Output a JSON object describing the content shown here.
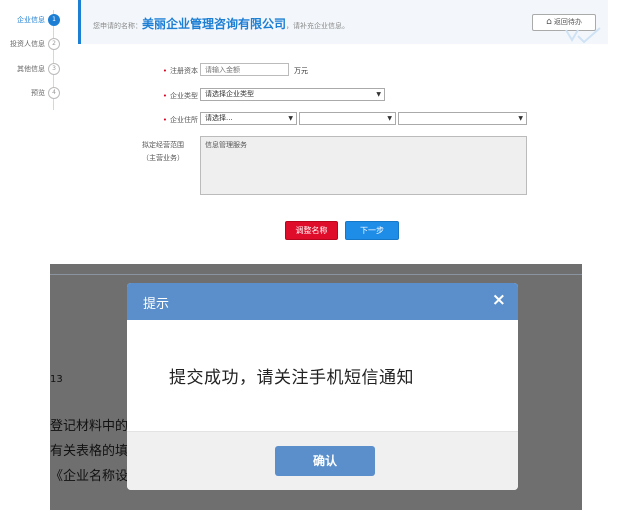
{
  "stepper": {
    "steps": [
      {
        "label": "企业信息",
        "num": "1"
      },
      {
        "label": "投资人信息",
        "num": "2"
      },
      {
        "label": "其他信息",
        "num": "3"
      },
      {
        "label": "预览",
        "num": "4"
      }
    ]
  },
  "notice": {
    "prefix": "您申请的名称：",
    "company": "美丽企业管理咨询有限公司",
    "suffix": "，请补充企业信息。",
    "back_label": "返回待办"
  },
  "form": {
    "capital": {
      "label": "注册资本",
      "placeholder": "请输入金额",
      "unit": "万元"
    },
    "type": {
      "label": "企业类型",
      "value": "请选择企业类型"
    },
    "address": {
      "label": "企业住所",
      "province": "请选择...",
      "city": "",
      "district": ""
    },
    "scope": {
      "label_line1": "拟定经营范围",
      "label_line2": "（主营业务）",
      "value": "信息管理服务"
    },
    "adjust_label": "调整名称",
    "next_label": "下一步"
  },
  "background": {
    "line1": "13",
    "line2": "登记材料中的复",
    "line3": "有关表格的填写",
    "line4": "《企业名称设立"
  },
  "modal": {
    "title": "提示",
    "close": "×",
    "message": "提交成功，请关注手机短信通知",
    "confirm_label": "确认"
  },
  "colors": {
    "accent": "#1d7fd4",
    "modal_header": "#5b8fcc",
    "danger": "#e00d2a",
    "overlay": "#6f6f6f"
  }
}
